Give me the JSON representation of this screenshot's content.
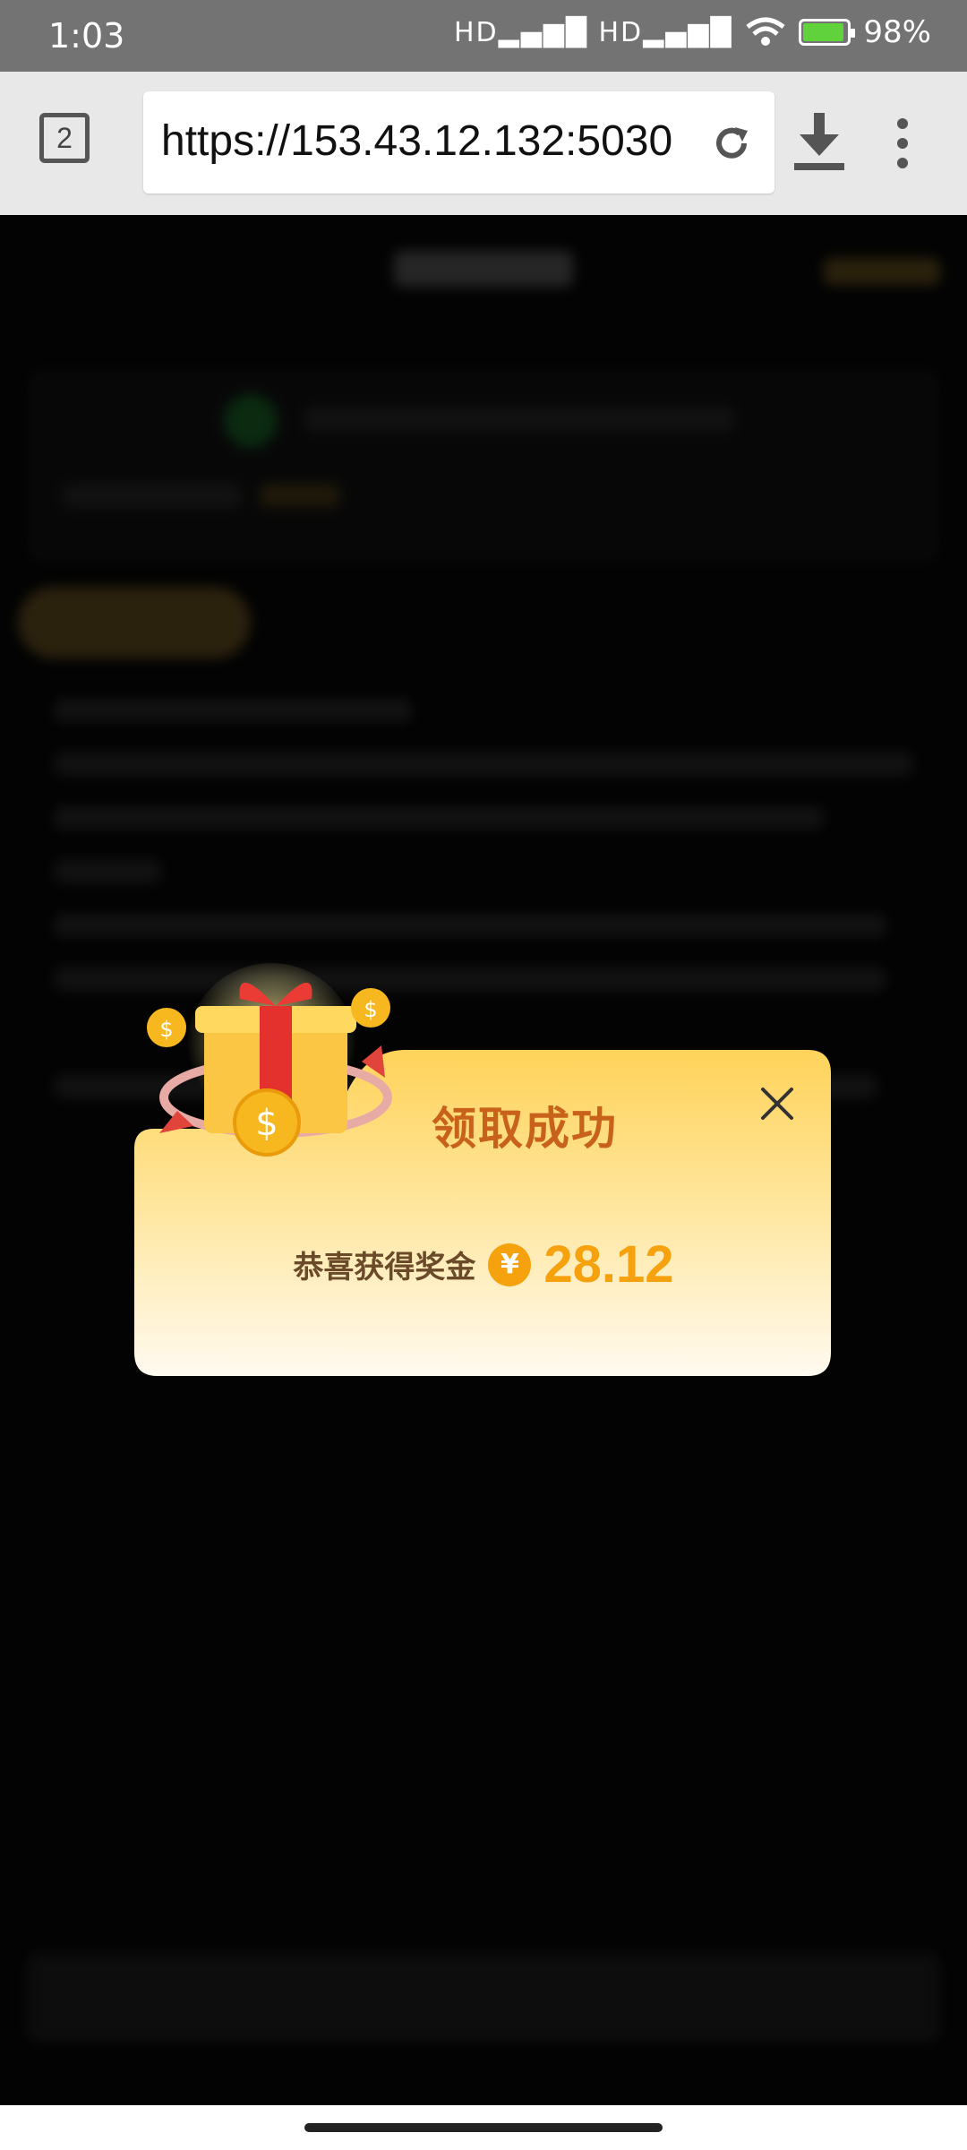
{
  "status_bar": {
    "time": "1:03",
    "signal": "HD▂▄▆█ HD▂▄▆█",
    "battery_pct": "98%"
  },
  "browser": {
    "tab_count": "2",
    "url": "https://153.43.12.132:5030"
  },
  "popup": {
    "title": "领取成功",
    "reward_label": "恭喜获得奖金",
    "currency_symbol": "¥",
    "amount": "28.12"
  },
  "colors": {
    "popup_title": "#c8621b",
    "amount": "#f6a20e",
    "popup_gradient_top": "#ffd35a",
    "popup_gradient_bottom": "#fffaf0"
  }
}
